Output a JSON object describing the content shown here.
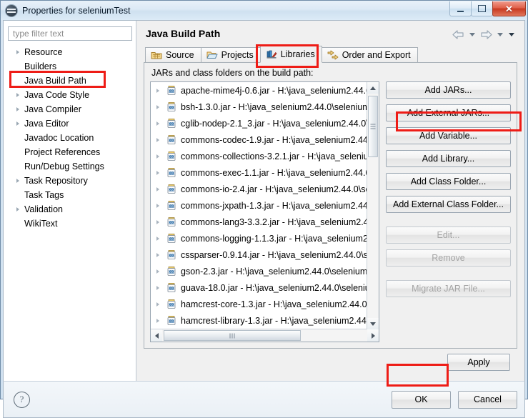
{
  "window": {
    "title": "Properties for seleniumTest",
    "icon": "eclipse-properties-icon",
    "minimize_label": "",
    "maximize_label": "",
    "close_label": "✕"
  },
  "sidebar": {
    "filter_placeholder": "type filter text",
    "filter_value": "",
    "items": [
      {
        "label": "Resource",
        "expandable": true,
        "selected": false
      },
      {
        "label": "Builders",
        "expandable": false,
        "selected": false
      },
      {
        "label": "Java Build Path",
        "expandable": false,
        "selected": true
      },
      {
        "label": "Java Code Style",
        "expandable": true,
        "selected": false
      },
      {
        "label": "Java Compiler",
        "expandable": true,
        "selected": false
      },
      {
        "label": "Java Editor",
        "expandable": true,
        "selected": false
      },
      {
        "label": "Javadoc Location",
        "expandable": false,
        "selected": false
      },
      {
        "label": "Project References",
        "expandable": false,
        "selected": false
      },
      {
        "label": "Run/Debug Settings",
        "expandable": false,
        "selected": false
      },
      {
        "label": "Task Repository",
        "expandable": true,
        "selected": false
      },
      {
        "label": "Task Tags",
        "expandable": false,
        "selected": false
      },
      {
        "label": "Validation",
        "expandable": true,
        "selected": false
      },
      {
        "label": "WikiText",
        "expandable": false,
        "selected": false
      }
    ]
  },
  "main": {
    "page_title": "Java Build Path",
    "nav": {
      "back_icon": "back-arrow-icon",
      "back_menu_icon": "chevron-down-icon",
      "forward_icon": "forward-arrow-icon",
      "forward_menu_icon": "chevron-down-icon",
      "overflow_icon": "chevron-down-solid-icon"
    },
    "tabs": [
      {
        "label": "Source",
        "icon": "source-folder-icon",
        "active": false
      },
      {
        "label": "Projects",
        "icon": "projects-folder-icon",
        "active": false
      },
      {
        "label": "Libraries",
        "icon": "libraries-books-icon",
        "active": true
      },
      {
        "label": "Order and Export",
        "icon": "order-export-icon",
        "active": false
      }
    ],
    "libraries": {
      "caption": "JARs and class folders on the build path:",
      "entries": [
        "apache-mime4j-0.6.jar - H:\\java_selenium2.44.0\\",
        "bsh-1.3.0.jar - H:\\java_selenium2.44.0\\selenium-",
        "cglib-nodep-2.1_3.jar - H:\\java_selenium2.44.0\\s",
        "commons-codec-1.9.jar - H:\\java_selenium2.44.",
        "commons-collections-3.2.1.jar - H:\\java_seleniu",
        "commons-exec-1.1.jar - H:\\java_selenium2.44.0\\",
        "commons-io-2.4.jar - H:\\java_selenium2.44.0\\se",
        "commons-jxpath-1.3.jar - H:\\java_selenium2.44.",
        "commons-lang3-3.3.2.jar - H:\\java_selenium2.44",
        "commons-logging-1.1.3.jar - H:\\java_selenium2",
        "cssparser-0.9.14.jar - H:\\java_selenium2.44.0\\se",
        "gson-2.3.jar - H:\\java_selenium2.44.0\\selenium-",
        "guava-18.0.jar - H:\\java_selenium2.44.0\\seleniur",
        "hamcrest-core-1.3.jar - H:\\java_selenium2.44.0\\",
        "hamcrest-library-1.3.jar - H:\\java_selenium2.44.("
      ],
      "entry_icon": "jar-file-icon",
      "buttons": [
        {
          "label": "Add JARs...",
          "enabled": true,
          "highlighted": false
        },
        {
          "label": "Add External JARs...",
          "enabled": true,
          "highlighted": true
        },
        {
          "label": "Add Variable...",
          "enabled": true,
          "highlighted": false
        },
        {
          "label": "Add Library...",
          "enabled": true,
          "highlighted": false
        },
        {
          "label": "Add Class Folder...",
          "enabled": true,
          "highlighted": false
        },
        {
          "label": "Add External Class Folder...",
          "enabled": true,
          "highlighted": false
        },
        {
          "label": "Edit...",
          "enabled": false,
          "highlighted": false
        },
        {
          "label": "Remove",
          "enabled": false,
          "highlighted": false
        },
        {
          "label": "Migrate JAR File...",
          "enabled": false,
          "highlighted": false
        }
      ]
    },
    "apply_label": "Apply"
  },
  "footer": {
    "help_icon": "help-question-icon",
    "help_glyph": "?",
    "ok_label": "OK",
    "cancel_label": "Cancel"
  },
  "annotations": {
    "accent_color": "#ee1c16",
    "highlights": [
      "java-build-path-item",
      "libraries-tab",
      "add-external-jars-button",
      "ok-button"
    ]
  }
}
